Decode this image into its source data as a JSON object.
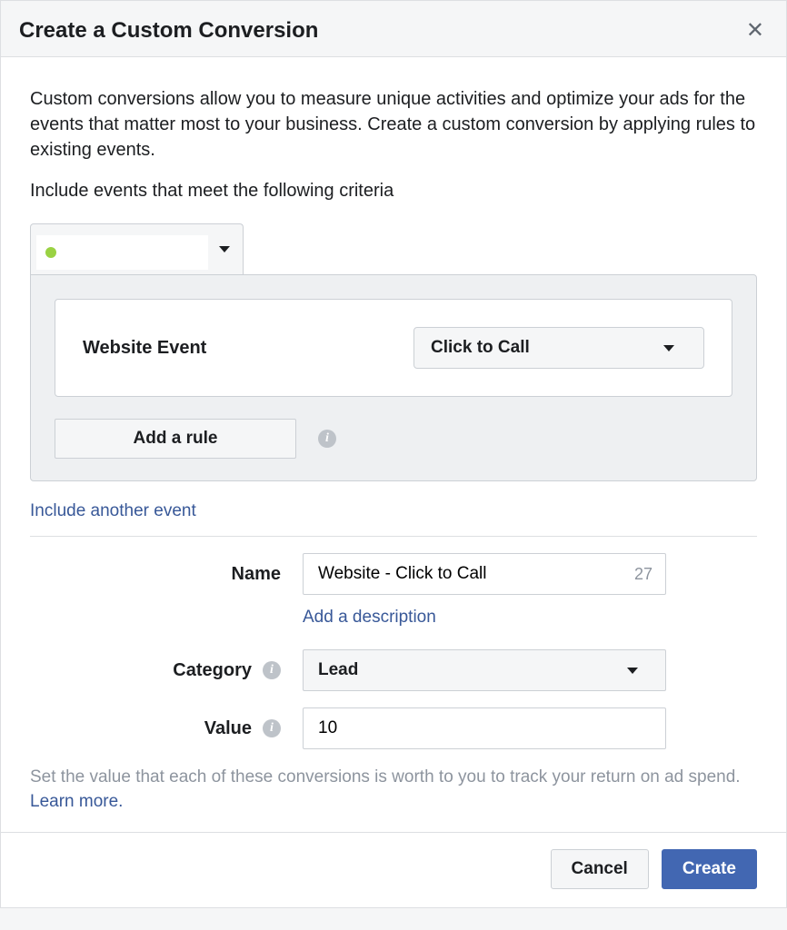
{
  "header": {
    "title": "Create a Custom Conversion"
  },
  "intro": "Custom conversions allow you to measure unique activities and optimize your ads for the events that matter most to your business. Create a custom conversion by applying rules to existing events.",
  "criteria_label": "Include events that meet the following criteria",
  "event_section": {
    "website_event_label": "Website Event",
    "website_event_value": "Click to Call",
    "add_rule_label": "Add a rule"
  },
  "include_another": "Include another event",
  "form": {
    "name_label": "Name",
    "name_value": "Website - Click to Call",
    "name_chars_left": "27",
    "add_description": "Add a description",
    "category_label": "Category",
    "category_value": "Lead",
    "value_label": "Value",
    "value_value": "10"
  },
  "helper": {
    "text": "Set the value that each of these conversions is worth to you to track your return on ad spend. ",
    "learn_more": "Learn more."
  },
  "footer": {
    "cancel": "Cancel",
    "create": "Create"
  }
}
